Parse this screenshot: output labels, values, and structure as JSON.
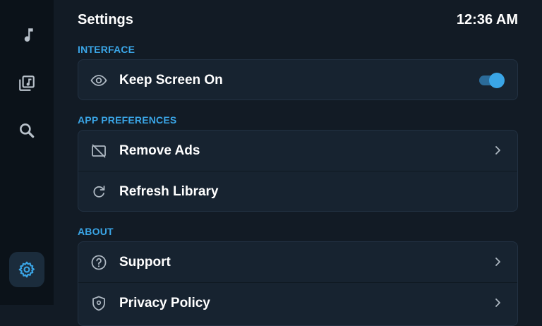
{
  "header": {
    "title": "Settings",
    "time": "12:36 AM"
  },
  "sidebar": {
    "items": [
      {
        "icon": "music-note-icon",
        "active": false
      },
      {
        "icon": "music-library-icon",
        "active": false
      },
      {
        "icon": "search-icon",
        "active": false
      },
      {
        "icon": "gear-icon",
        "active": true
      }
    ]
  },
  "sections": {
    "interface": {
      "label": "INTERFACE",
      "items": [
        {
          "label": "Keep Screen On",
          "icon": "eye-icon",
          "toggle_on": true
        }
      ]
    },
    "app_preferences": {
      "label": "APP PREFERENCES",
      "items": [
        {
          "label": "Remove Ads",
          "icon": "no-ads-icon"
        },
        {
          "label": "Refresh Library",
          "icon": "refresh-icon"
        }
      ]
    },
    "about": {
      "label": "ABOUT",
      "items": [
        {
          "label": "Support",
          "icon": "help-circle-icon"
        },
        {
          "label": "Privacy Policy",
          "icon": "shield-icon"
        }
      ]
    }
  },
  "colors": {
    "accent": "#3aa5e6",
    "background": "#121b25",
    "sidebar": "#0b1219",
    "card": "#172330"
  }
}
